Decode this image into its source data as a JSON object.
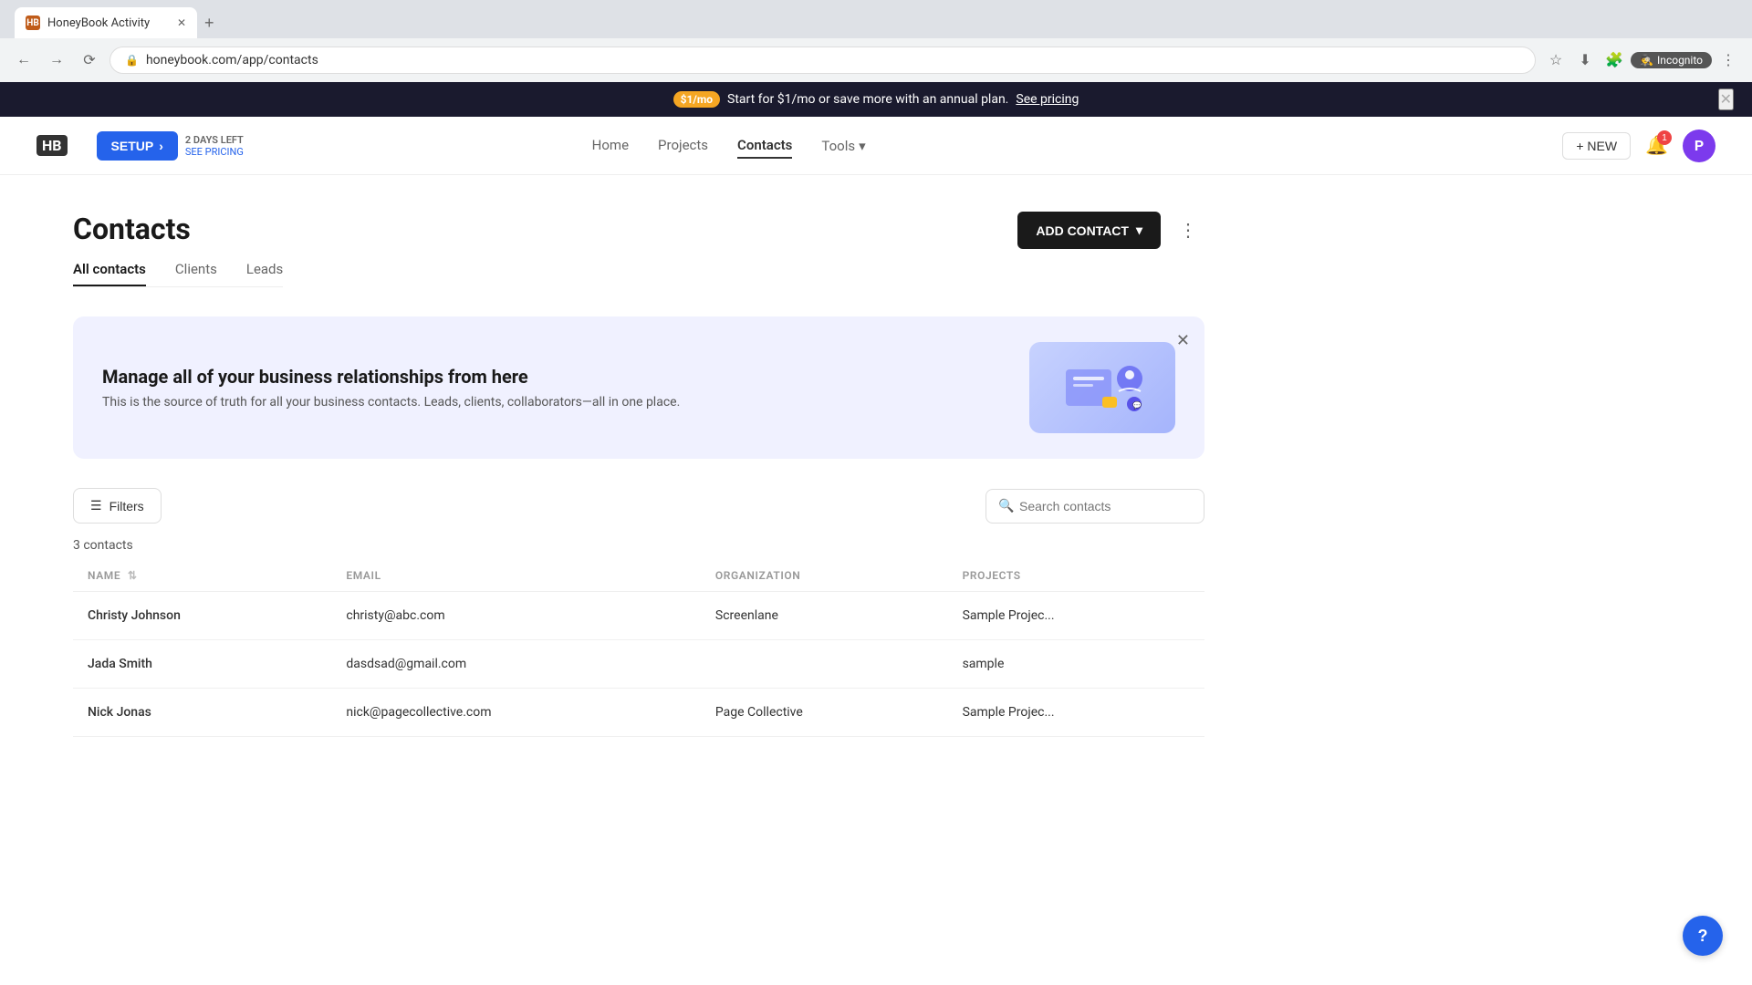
{
  "browser": {
    "tab_title": "HoneyBook Activity",
    "tab_icon": "HB",
    "url": "honeybook.com/app/contacts",
    "incognito_label": "Incognito"
  },
  "banner": {
    "badge": "$1/mo",
    "text": "Start for $1/mo or save more with an annual plan.",
    "link": "See pricing",
    "close_icon": "✕"
  },
  "header": {
    "logo": "HB",
    "setup_label": "SETUP",
    "setup_arrow": "→",
    "days_left": "2 DAYS LEFT",
    "see_pricing": "SEE PRICING",
    "nav": {
      "home": "Home",
      "projects": "Projects",
      "contacts": "Contacts",
      "tools": "Tools"
    },
    "new_button": "+ NEW",
    "notif_count": "1",
    "avatar_letter": "P"
  },
  "page": {
    "title": "Contacts",
    "tabs": [
      {
        "label": "All contacts",
        "active": true
      },
      {
        "label": "Clients",
        "active": false
      },
      {
        "label": "Leads",
        "active": false
      }
    ],
    "add_contact_label": "ADD CONTACT",
    "more_icon": "⋮"
  },
  "info_banner": {
    "heading": "Manage all of your business relationships from here",
    "body": "This is the source of truth for all your business contacts. Leads, clients, collaborators—all in one place.",
    "close_icon": "✕"
  },
  "filters": {
    "filter_label": "Filters",
    "search_placeholder": "Search contacts"
  },
  "contacts": {
    "count_label": "3 contacts",
    "columns": {
      "name": "NAME",
      "email": "EMAIL",
      "organization": "ORGANIZATION",
      "projects": "PROJECTS"
    },
    "rows": [
      {
        "name": "Christy Johnson",
        "email": "christy@abc.com",
        "organization": "Screenlane",
        "projects": "Sample Projec..."
      },
      {
        "name": "Jada Smith",
        "email": "dasdsad@gmail.com",
        "organization": "",
        "projects": "sample"
      },
      {
        "name": "Nick Jonas",
        "email": "nick@pagecollective.com",
        "organization": "Page Collective",
        "projects": "Sample Projec..."
      }
    ]
  },
  "help": {
    "label": "?"
  }
}
